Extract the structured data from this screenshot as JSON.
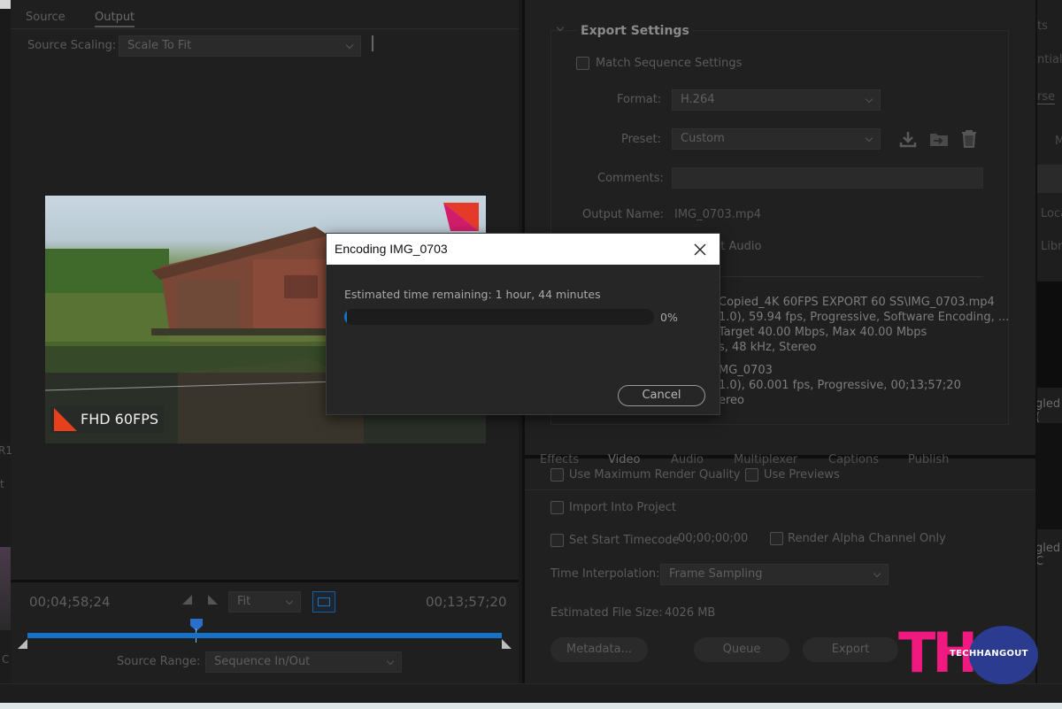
{
  "left_panel": {
    "tabs": [
      "Source",
      "Output"
    ],
    "source_scaling_label": "Source Scaling:",
    "source_scaling_value": "Scale To Fit",
    "overlay_text": "FHD 60FPS",
    "timecode_left": "00;04;58;24",
    "timecode_right": "00;13;57;20",
    "fit_value": "Fit",
    "source_range_label": "Source Range:",
    "source_range_value": "Sequence In/Out",
    "playhead_progress": 0.36,
    "edge_letters": [
      "R1",
      "t",
      "C"
    ]
  },
  "export_settings": {
    "heading": "Export Settings",
    "match_sequence": "Match Sequence Settings",
    "format_label": "Format:",
    "format_value": "H.264",
    "preset_label": "Preset:",
    "preset_value": "Custom",
    "comments_label": "Comments:",
    "output_name_label": "Output Name:",
    "output_name_value": "IMG_0703.mp4",
    "export_audio_partial": "ort Audio",
    "summary_output": [
      "Copied_4K 60FPS EXPORT 60 SS\\IMG_0703.mp4",
      "1.0), 59.94 fps, Progressive, Software Encoding, ...",
      "Target 40.00 Mbps, Max 40.00 Mbps",
      "s, 48 kHz, Stereo"
    ],
    "summary_source": [
      "MG_0703",
      "1.0), 60.001 fps, Progressive, 00;13;57;20",
      "ereo"
    ]
  },
  "tabs_row": [
    "Effects",
    "Video",
    "Audio",
    "Multiplexer",
    "Captions",
    "Publish"
  ],
  "options": {
    "max_render_quality": "Use Maximum Render Quality",
    "use_previews": "Use Previews",
    "import_into_project": "Import Into Project",
    "set_start_timecode": "Set Start Timecode",
    "start_timecode_value": "00;00;00;00",
    "render_alpha": "Render Alpha Channel Only",
    "time_interpolation_label": "Time Interpolation:",
    "time_interpolation_value": "Frame Sampling",
    "estimated_size_label": "Estimated File Size:",
    "estimated_size_value": "4026 MB"
  },
  "buttons": {
    "metadata": "Metadata...",
    "queue": "Queue",
    "export": "Export"
  },
  "right_edge": {
    "texts": [
      "ts",
      "ntial",
      "rse",
      "M",
      "Loca",
      "Libr",
      "gled (",
      "gled C"
    ]
  },
  "dialog": {
    "title": "Encoding IMG_0703",
    "estimate": "Estimated time remaining: 1 hour, 44 minutes",
    "percent": "0%",
    "progress": 0.0,
    "cancel": "Cancel"
  },
  "watermark": {
    "letters": "TH",
    "brand": "TECHHANGOUT"
  },
  "colors": {
    "accent_blue": "#1473c8",
    "watermark_pink": "#f0197f",
    "watermark_navy": "#2b3b8f"
  }
}
